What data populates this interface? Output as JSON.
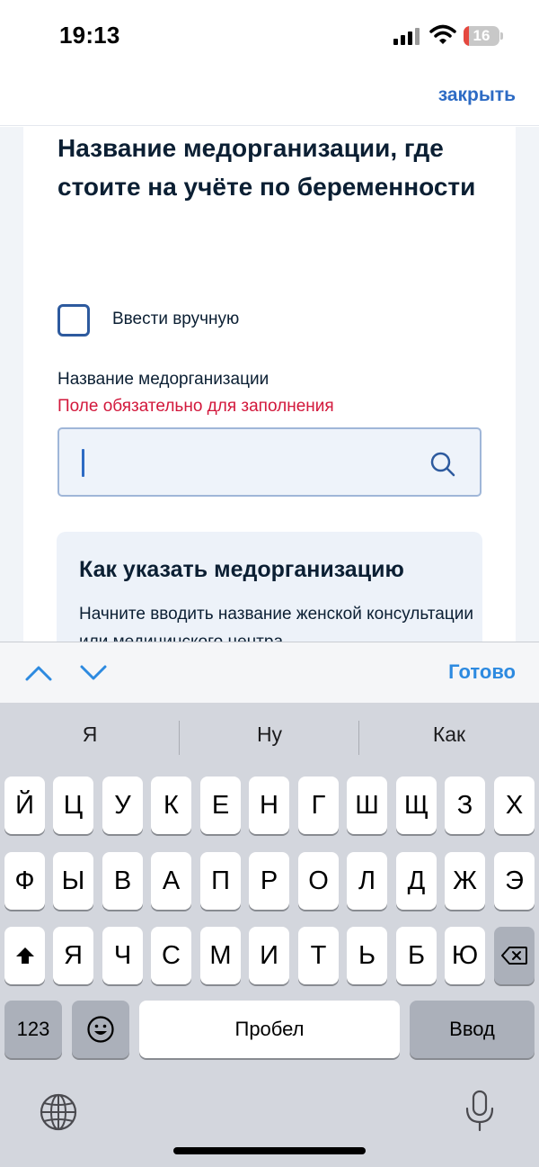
{
  "status_bar": {
    "time": "19:13",
    "battery": "16",
    "battery_level": 0.16,
    "battery_color": "#e5483f"
  },
  "header": {
    "close_label": "закрыть"
  },
  "form": {
    "title": "Название медорганизации, где стоите на учёте по беременности",
    "manual_checkbox_label": "Ввести вручную",
    "manual_checked": false,
    "field_label": "Название медорганизации",
    "field_error": "Поле обязательно для заполнения",
    "search_value": ""
  },
  "hint": {
    "title": "Как указать медорганизацию",
    "text": "Начните вводить название женской консультации или медицинского центра"
  },
  "keyboard_toolbar": {
    "done_label": "Готово"
  },
  "keyboard": {
    "suggestions": [
      "Я",
      "Ну",
      "Как"
    ],
    "row1": [
      "Й",
      "Ц",
      "У",
      "К",
      "Е",
      "Н",
      "Г",
      "Ш",
      "Щ",
      "З",
      "Х"
    ],
    "row2": [
      "Ф",
      "Ы",
      "В",
      "А",
      "П",
      "Р",
      "О",
      "Л",
      "Д",
      "Ж",
      "Э"
    ],
    "row3": [
      "Я",
      "Ч",
      "С",
      "М",
      "И",
      "Т",
      "Ь",
      "Б",
      "Ю"
    ],
    "numbers_label": "123",
    "space_label": "Пробел",
    "enter_label": "Ввод"
  },
  "colors": {
    "accent": "#2d6bc4",
    "error": "#d2173b",
    "done": "#2d8ae0"
  }
}
